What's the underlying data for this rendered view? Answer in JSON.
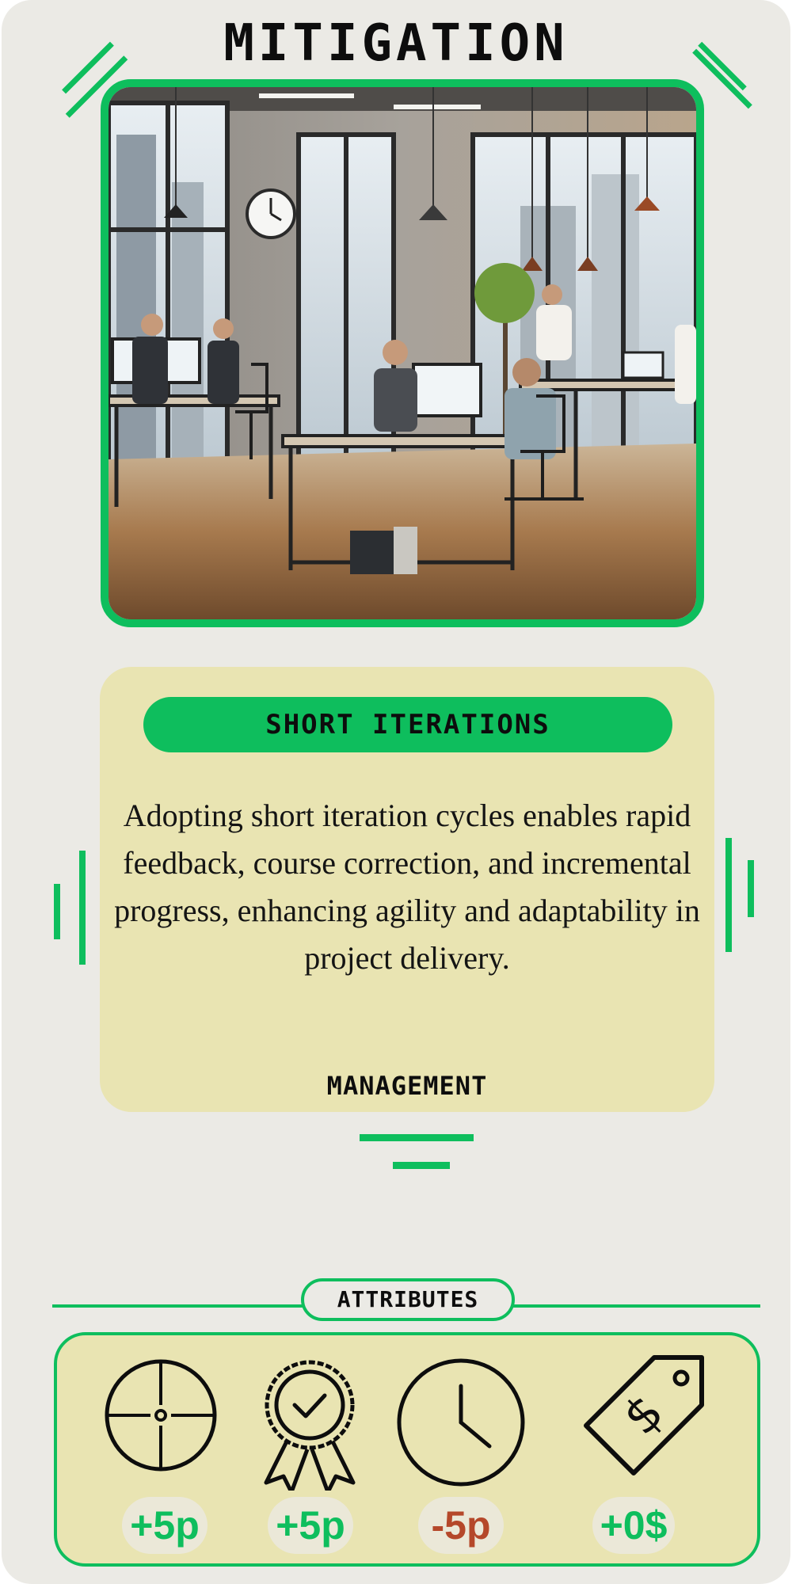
{
  "card": {
    "title": "MITIGATION",
    "accent_color": "#0ebe5d",
    "panel_color": "#e9e4b2",
    "background_color": "#ebeae5",
    "image": "office-scene-illustration"
  },
  "mitigation": {
    "name": "SHORT ITERATIONS",
    "description": "Adopting short iteration cycles enables rapid feedback, course correction, and incremental progress, enhancing agility and adaptability in project delivery.",
    "category": "MANAGEMENT"
  },
  "attributes": {
    "heading": "ATTRIBUTES",
    "items": [
      {
        "icon": "crosshair-icon",
        "value": "+5p",
        "color": "#0ebe5d"
      },
      {
        "icon": "award-ribbon-icon",
        "value": "+5p",
        "color": "#0ebe5d"
      },
      {
        "icon": "clock-icon",
        "value": "-5p",
        "color": "#b5482a"
      },
      {
        "icon": "price-tag-icon",
        "value": "+0$",
        "color": "#0ebe5d"
      }
    ]
  }
}
